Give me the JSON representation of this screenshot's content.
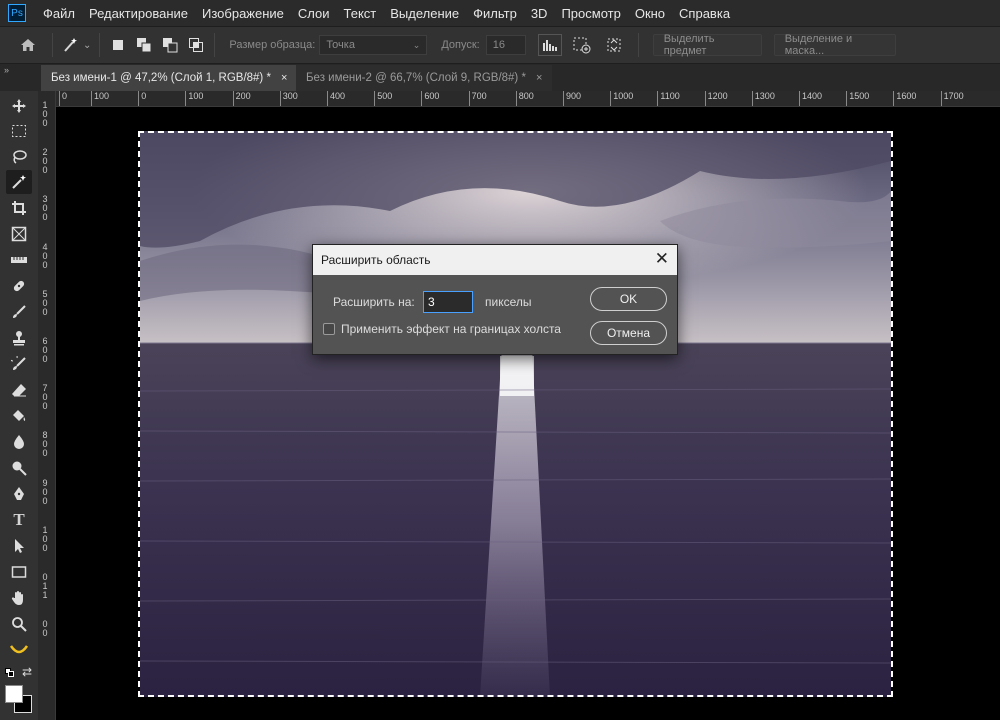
{
  "app": {
    "logo": "Ps"
  },
  "menu": [
    "Файл",
    "Редактирование",
    "Изображение",
    "Слои",
    "Текст",
    "Выделение",
    "Фильтр",
    "3D",
    "Просмотр",
    "Окно",
    "Справка"
  ],
  "options": {
    "sample_size_label": "Размер образца:",
    "sample_size_value": "Точка",
    "tolerance_label": "Допуск:",
    "tolerance_value": "16",
    "select_subject": "Выделить предмет",
    "select_and_mask": "Выделение и маска..."
  },
  "tabs": [
    {
      "label": "Без имени-1 @ 47,2% (Слой 1, RGB/8#) *",
      "close": "×"
    },
    {
      "label": "Без имени-2 @ 66,7% (Слой 9, RGB/8#) *",
      "close": "×"
    }
  ],
  "hruler_ticks": [
    "0",
    "100",
    "0",
    "100",
    "200",
    "300",
    "400",
    "500",
    "600",
    "700",
    "800",
    "900",
    "1000",
    "1100",
    "1200",
    "1300",
    "1400",
    "1500",
    "1600",
    "1700"
  ],
  "vruler_labels": [
    "1",
    "0",
    "0",
    "2",
    "0",
    "0",
    "3",
    "0",
    "0",
    "4",
    "0",
    "0",
    "5",
    "0",
    "0",
    "6",
    "0",
    "0",
    "7",
    "0",
    "0",
    "8",
    "0",
    "0",
    "9",
    "0",
    "0",
    "1",
    "0",
    "0",
    "0",
    "1",
    "1",
    "0",
    "0"
  ],
  "dialog": {
    "title": "Расширить область",
    "expand_label": "Расширить на:",
    "expand_value": "3",
    "unit": "пикселы",
    "apply_canvas_label": "Применить эффект на границах холста",
    "ok": "OK",
    "cancel": "Отмена"
  },
  "colors": {
    "accent": "#31a8ff",
    "canvas_bg": "#000000",
    "panel": "#323232"
  }
}
